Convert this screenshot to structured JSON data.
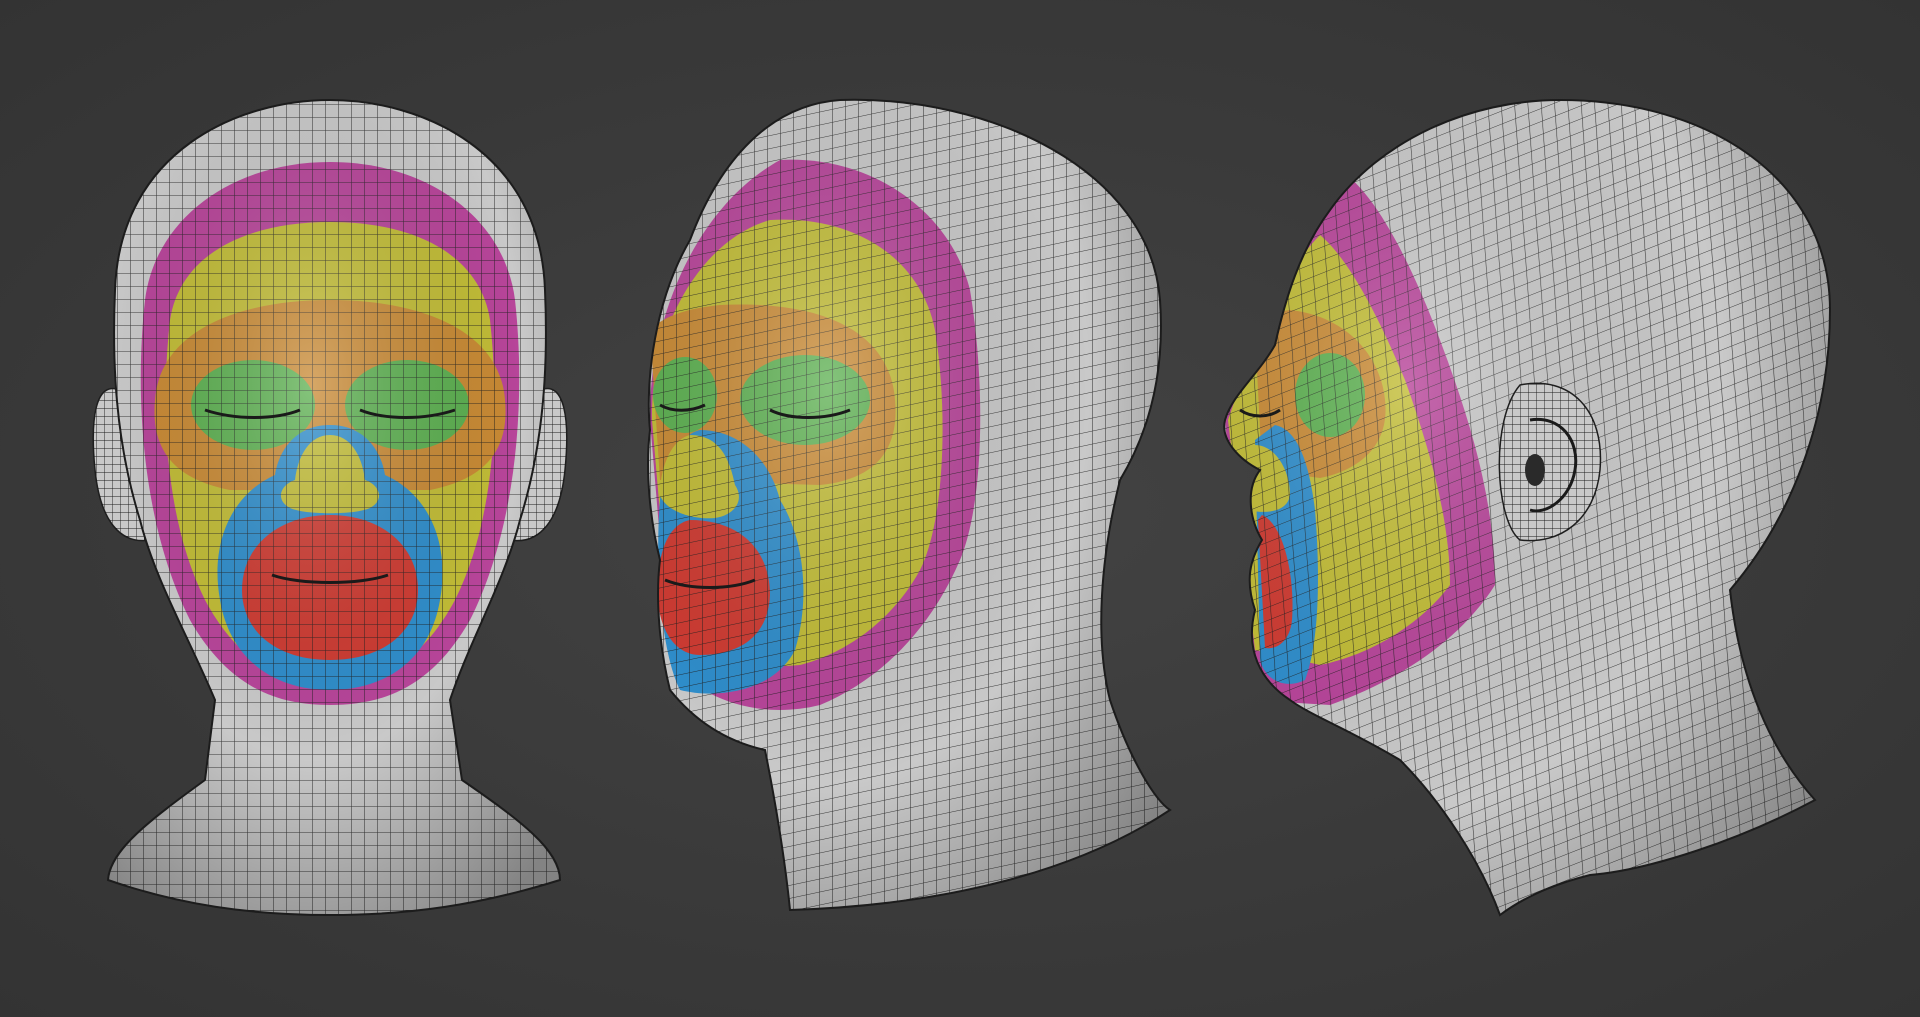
{
  "scene": {
    "background": "#3b3b3b",
    "views": [
      "front-view",
      "three-quarter-view",
      "side-view"
    ],
    "region_colors": {
      "base_mesh": "#c9c9c9",
      "forehead_ring": "#b8459a",
      "upper_face": "#c2bd36",
      "eye_socket_ring": "#c98a34",
      "eyes": "#5cb050",
      "nose_mouth_ring": "#2f8ecc",
      "mouth": "#cf3b32",
      "wire": "#1e1e1e"
    }
  }
}
